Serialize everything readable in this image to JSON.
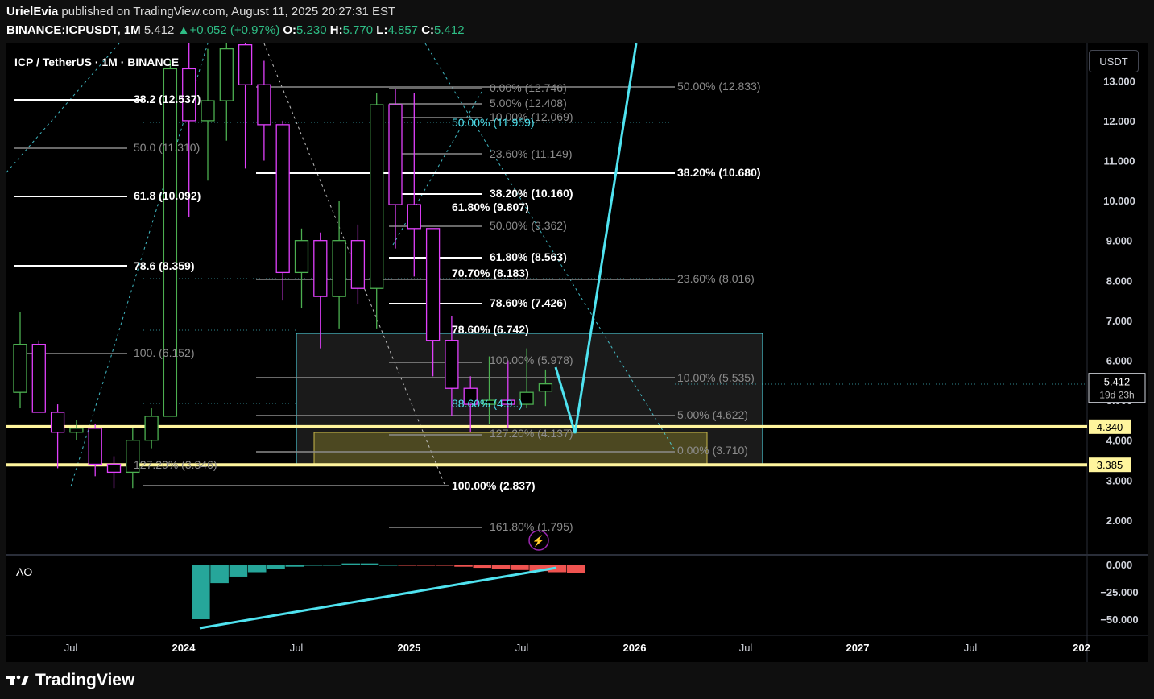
{
  "header": {
    "author": "UrielEvia",
    "published_text": "published on TradingView.com, August 11, 2025 20:27:31 EST",
    "symbol": "BINANCE:ICPUSDT, 1M",
    "last": "5.412",
    "change_arrow": "▲",
    "change": "+0.052 (+0.97%)",
    "open_label": "O:",
    "open": "5.230",
    "high_label": "H:",
    "high": "5.770",
    "low_label": "L:",
    "low": "4.857",
    "close_label": "C:",
    "close": "5.412"
  },
  "chart_title": "ICP / TetherUS · 1M · BINANCE",
  "currency_button": "USDT",
  "price_scale_labels": [
    "13.000",
    "12.000",
    "11.000",
    "10.000",
    "9.000",
    "8.000",
    "7.000",
    "6.000",
    "5.000",
    "4.000",
    "3.000",
    "2.000"
  ],
  "price_badges": [
    {
      "text": "5.412",
      "sub": "19d 23h",
      "style": "current"
    },
    {
      "text": "4.340",
      "style": "level"
    },
    {
      "text": "3.385",
      "style": "level"
    }
  ],
  "time_labels": [
    "Jul",
    "2024",
    "Jul",
    "2025",
    "Jul",
    "2026",
    "Jul",
    "2027",
    "Jul",
    "202"
  ],
  "indicator": {
    "name": "AO",
    "scale_labels": [
      "0.000",
      "−25.000",
      "−50.000"
    ]
  },
  "footer": {
    "brand": "TradingView"
  },
  "colors": {
    "bull": "#4caf50",
    "bear": "#e040fb",
    "level_line": "#fff59d",
    "arrow": "#4fe3f0",
    "fib_cyan": "#4fe3f0",
    "ao_green": "#26a69a",
    "ao_red": "#ef5350"
  },
  "fib_labels": [
    {
      "text": "38.2",
      "suffix": "(12.537)",
      "style": "white"
    },
    {
      "text": "50.0",
      "suffix": "(11.310)",
      "style": "gray"
    },
    {
      "text": "61.8",
      "suffix": "(10.092)",
      "style": "white"
    },
    {
      "text": "78.6",
      "suffix": "(8.359)",
      "style": "white"
    },
    {
      "text": "100.",
      "suffix": "(6.152)",
      "style": "gray"
    },
    {
      "text": "127.20% (3.346)",
      "style": "gray"
    },
    {
      "text": "0.00% (12.746)",
      "style": "gray"
    },
    {
      "text": "5.00% (12.408)",
      "style": "gray"
    },
    {
      "text": "10.00% (12.069)",
      "style": "gray"
    },
    {
      "text": "50.00% (11.959)",
      "style": "cyan"
    },
    {
      "text": "23.60% (11.149)",
      "style": "gray"
    },
    {
      "text": "38.20% (10.160)",
      "style": "white"
    },
    {
      "text": "61.80% (9.807)",
      "style": "white"
    },
    {
      "text": "50.00% (9.362)",
      "style": "gray"
    },
    {
      "text": "61.80% (8.563)",
      "style": "white"
    },
    {
      "text": "70.70% (8.183)",
      "style": "white"
    },
    {
      "text": "78.60% (7.426)",
      "style": "white"
    },
    {
      "text": "78.60% (6.742)",
      "style": "white"
    },
    {
      "text": "100.00% (5.978)",
      "style": "gray"
    },
    {
      "text": "88.60% (4.9..)",
      "style": "cyan"
    },
    {
      "text": "127.20% (4.137)",
      "style": "gray"
    },
    {
      "text": "100.00% (2.837)",
      "style": "white"
    },
    {
      "text": "161.80% (1.795)",
      "style": "gray"
    },
    {
      "text": "50.00% (12.833)",
      "style": "gray"
    },
    {
      "text": "38.20% (10.680)",
      "style": "white"
    },
    {
      "text": "23.60% (8.016)",
      "style": "gray"
    },
    {
      "text": "10.00% (5.535)",
      "style": "gray"
    },
    {
      "text": "5.00% (4.622)",
      "style": "gray"
    },
    {
      "text": "0.00% (3.710)",
      "style": "gray"
    }
  ],
  "chart_data": {
    "type": "candlestick",
    "title": "ICP / TetherUS · 1M · BINANCE",
    "interval": "1M",
    "ylabel": "USDT",
    "ylim": [
      1.0,
      13.2
    ],
    "x_axis": [
      "Jul",
      "2024",
      "Jul",
      "2025",
      "Jul",
      "2026",
      "Jul",
      "2027",
      "Jul"
    ],
    "candles": [
      {
        "o": 5.2,
        "h": 7.2,
        "l": 4.8,
        "c": 6.4
      },
      {
        "o": 6.4,
        "h": 6.5,
        "l": 4.7,
        "c": 4.7
      },
      {
        "o": 4.7,
        "h": 4.9,
        "l": 3.3,
        "c": 4.2
      },
      {
        "o": 4.2,
        "h": 4.5,
        "l": 4.0,
        "c": 4.3
      },
      {
        "o": 4.3,
        "h": 4.4,
        "l": 3.1,
        "c": 3.4
      },
      {
        "o": 3.4,
        "h": 3.6,
        "l": 2.8,
        "c": 3.2
      },
      {
        "o": 3.2,
        "h": 4.3,
        "l": 2.8,
        "c": 4.0
      },
      {
        "o": 4.0,
        "h": 4.8,
        "l": 3.8,
        "c": 4.6
      },
      {
        "o": 4.6,
        "h": 13.5,
        "l": 4.6,
        "c": 13.3
      },
      {
        "o": 13.3,
        "h": 14.0,
        "l": 9.6,
        "c": 12.0
      },
      {
        "o": 12.0,
        "h": 13.8,
        "l": 10.5,
        "c": 12.5
      },
      {
        "o": 12.5,
        "h": 14.0,
        "l": 11.5,
        "c": 13.8
      },
      {
        "o": 13.9,
        "h": 14.5,
        "l": 10.8,
        "c": 12.9
      },
      {
        "o": 12.9,
        "h": 13.5,
        "l": 11.0,
        "c": 11.9
      },
      {
        "o": 11.9,
        "h": 12.0,
        "l": 7.5,
        "c": 8.2
      },
      {
        "o": 8.2,
        "h": 9.3,
        "l": 7.3,
        "c": 9.0
      },
      {
        "o": 9.0,
        "h": 9.2,
        "l": 6.3,
        "c": 7.6
      },
      {
        "o": 7.6,
        "h": 10.0,
        "l": 6.8,
        "c": 9.0
      },
      {
        "o": 9.0,
        "h": 9.4,
        "l": 7.4,
        "c": 7.8
      },
      {
        "o": 7.8,
        "h": 12.7,
        "l": 6.8,
        "c": 12.4
      },
      {
        "o": 12.4,
        "h": 12.8,
        "l": 8.8,
        "c": 9.9
      },
      {
        "o": 9.9,
        "h": 12.7,
        "l": 8.1,
        "c": 9.3
      },
      {
        "o": 9.3,
        "h": 9.3,
        "l": 5.6,
        "c": 6.5
      },
      {
        "o": 6.5,
        "h": 7.1,
        "l": 4.6,
        "c": 5.3
      },
      {
        "o": 5.3,
        "h": 5.6,
        "l": 4.2,
        "c": 4.9
      },
      {
        "o": 4.9,
        "h": 6.1,
        "l": 4.4,
        "c": 5.0
      },
      {
        "o": 5.0,
        "h": 6.0,
        "l": 4.3,
        "c": 4.9
      },
      {
        "o": 4.9,
        "h": 6.3,
        "l": 4.8,
        "c": 5.2
      },
      {
        "o": 5.23,
        "h": 5.77,
        "l": 4.857,
        "c": 5.412
      }
    ],
    "horizontal_levels": [
      4.34,
      3.385
    ],
    "current_price": 5.412,
    "ao_histogram": [
      -50,
      -17,
      -11,
      -7,
      -4,
      -2,
      -1,
      0,
      1,
      1,
      0,
      0,
      -1,
      -1,
      -2,
      -3,
      -4,
      -5,
      -6,
      -7,
      -8
    ]
  }
}
